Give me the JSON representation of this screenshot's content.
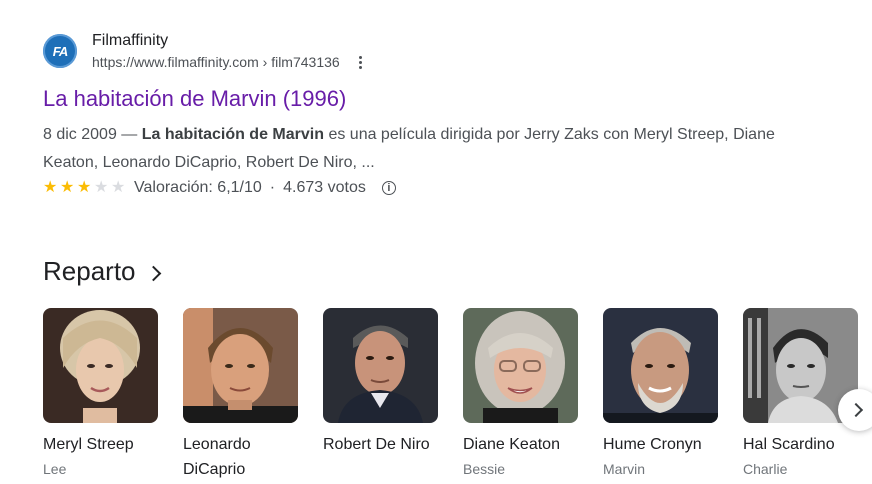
{
  "result": {
    "site_name": "Filmaffinity",
    "favicon_text": "FA",
    "url": "https://www.filmaffinity.com › film743136",
    "title": "La habitación de Marvin (1996)",
    "snippet": {
      "date": "8 dic 2009 — ",
      "bold": "La habitación de Marvin",
      "rest": " es una película dirigida por Jerry Zaks con Meryl Streep, Diane Keaton, Leonardo DiCaprio, Robert De Niro, ..."
    },
    "rating": {
      "stars_filled": 3,
      "stars_total": 5,
      "label": "Valoración: 6,1/10",
      "separator": "·",
      "votes": "4.673 votos"
    }
  },
  "cast": {
    "title": "Reparto",
    "members": [
      {
        "name": "Meryl Streep",
        "role": "Lee"
      },
      {
        "name": "Leonardo DiCaprio",
        "role": ""
      },
      {
        "name": "Robert De Niro",
        "role": ""
      },
      {
        "name": "Diane Keaton",
        "role": "Bessie"
      },
      {
        "name": "Hume Cronyn",
        "role": "Marvin"
      },
      {
        "name": "Hal Scardino",
        "role": "Charlie"
      }
    ]
  },
  "colors": {
    "title_link": "#681da8",
    "star_on": "#fbbc04",
    "star_off": "#dadce0"
  }
}
